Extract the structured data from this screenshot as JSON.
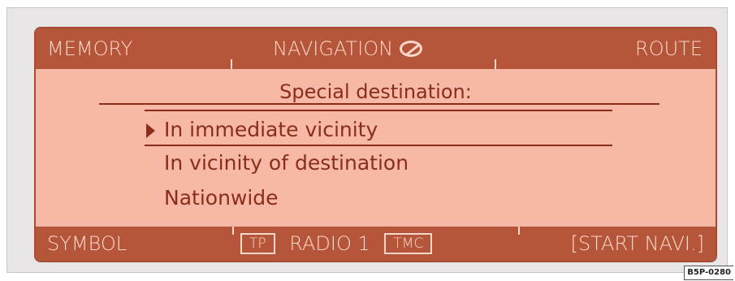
{
  "header": {
    "left_label": "MEMORY",
    "center_label": "NAVIGATION",
    "center_icon": "compass-icon",
    "right_label": "ROUTE"
  },
  "menu": {
    "title": "Special destination:",
    "selected_index": 0,
    "items": [
      {
        "label": "In immediate vicinity"
      },
      {
        "label": "In vicinity of destination"
      },
      {
        "label": "Nationwide"
      }
    ]
  },
  "footer": {
    "symbol_label": "SYMBOL",
    "tp_label": "TP",
    "radio_label": "RADIO 1",
    "tmc_label": "TMC",
    "start_label": "[START NAVI.]"
  },
  "figure_ref": "B5P-0280",
  "colors": {
    "screen_background": "#f7b9a6",
    "bar_background": "#b5563a",
    "bar_text": "#ffd7c9",
    "menu_text": "#8a2e1b"
  }
}
